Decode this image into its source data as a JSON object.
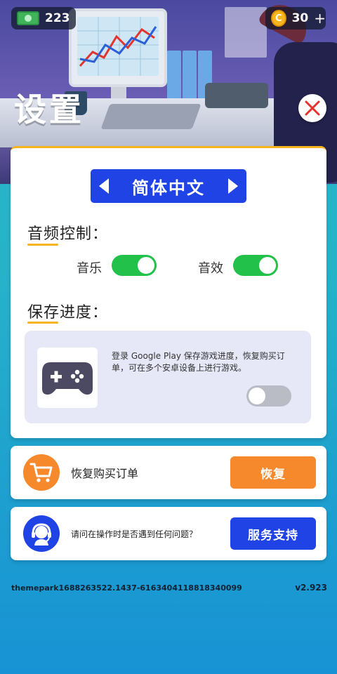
{
  "topbar": {
    "cash_amount": "223",
    "coin_amount": "30",
    "coin_plus": "+"
  },
  "header": {
    "title": "设置"
  },
  "language": {
    "current": "简体中文"
  },
  "audio": {
    "section_title": "音频控制：",
    "music_label": "音乐",
    "music_on": true,
    "sfx_label": "音效",
    "sfx_on": true
  },
  "save": {
    "section_title": "保存进度：",
    "description": "登录 Google Play 保存游戏进度，恢复购买订单，可在多个安卓设备上进行游戏。",
    "google_play_on": false
  },
  "restore": {
    "label": "恢复购买订单",
    "button": "恢复"
  },
  "support": {
    "label": "请问在操作时是否遇到任何问题？",
    "button": "服务支持"
  },
  "footer": {
    "id": "themepark1688263522.1437-6163404118818340099",
    "version": "v2.923"
  },
  "colors": {
    "accent_blue": "#1f43e4",
    "toggle_green": "#22c14a",
    "orange": "#f5892b",
    "underline_yellow": "#f6b51d"
  }
}
